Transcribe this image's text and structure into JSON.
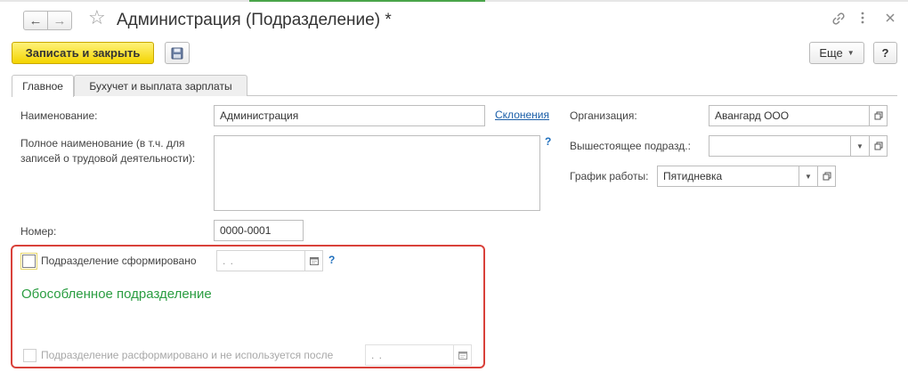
{
  "window": {
    "title": "Администрация (Подразделение) *",
    "icons": [
      "link-icon",
      "more-vertical-icon",
      "close-icon"
    ]
  },
  "toolbar": {
    "save_close_label": "Записать и закрыть",
    "more_label": "Еще",
    "help_label": "?"
  },
  "tabs": [
    {
      "label": "Главное",
      "active": true
    },
    {
      "label": "Бухучет и выплата зарплаты",
      "active": false
    }
  ],
  "form": {
    "name_label": "Наименование:",
    "name_value": "Администрация",
    "declensions_link": "Склонения",
    "full_name_label_line1": "Полное наименование (в т.ч. для",
    "full_name_label_line2": "записей о трудовой деятельности):",
    "full_name_value": "",
    "help_mark": "?",
    "number_label": "Номер:",
    "number_value": "0000-0001",
    "organization_label": "Организация:",
    "organization_value": "Авангард ООО",
    "parent_label": "Вышестоящее подразд.:",
    "parent_value": "",
    "schedule_label": "График работы:",
    "schedule_value": "Пятидневка"
  },
  "section": {
    "formed_label": "Подразделение сформировано",
    "formed_checked": false,
    "formed_date_placeholder": ". .",
    "help_mark": "?",
    "separate_division_title": "Обособленное подразделение",
    "disbanded_label": "Подразделение расформировано и не используется после",
    "disbanded_checked": false,
    "disbanded_date_placeholder": ". ."
  }
}
